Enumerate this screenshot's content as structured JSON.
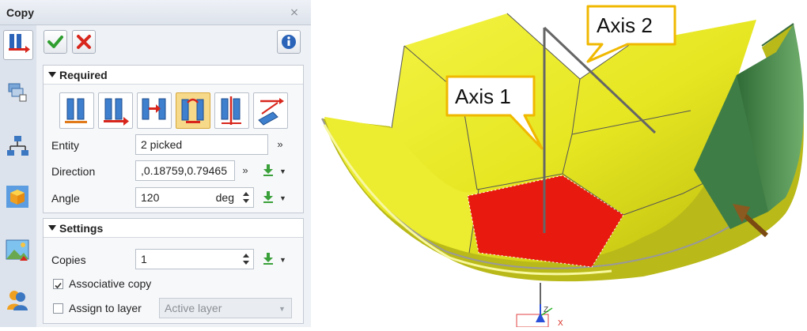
{
  "panel": {
    "title": "Copy",
    "close_glyph": "⨯"
  },
  "sidebar_icons": [
    "copy-tool-icon",
    "layers-icon",
    "hierarchy-icon",
    "cube-icon",
    "image-icon",
    "user-icon"
  ],
  "toolbar": {
    "ok": "OK",
    "cancel": "Cancel",
    "info": "Info"
  },
  "required": {
    "title": "Required",
    "modes": [
      "translate-copy",
      "move-copy",
      "point-to-point-copy",
      "rotate-copy",
      "axis-copy",
      "align-copy"
    ],
    "selected_mode": 3,
    "entity": {
      "label": "Entity",
      "value": "2 picked"
    },
    "direction": {
      "label": "Direction",
      "value": ",0.18759,0.79465"
    },
    "angle": {
      "label": "Angle",
      "value": "120",
      "unit": "deg"
    }
  },
  "settings": {
    "title": "Settings",
    "copies": {
      "label": "Copies",
      "value": "1"
    },
    "associative": {
      "label": "Associative copy",
      "checked": true
    },
    "assign_layer": {
      "label": "Assign to layer",
      "checked": false,
      "value": "Active layer"
    }
  },
  "viewport": {
    "callouts": [
      "Axis 1",
      "Axis 2"
    ],
    "triad": {
      "z": "Z",
      "x": "X"
    },
    "colors": {
      "yellow": "#ecec2a",
      "red": "#e81a10",
      "green": "#3f7d46",
      "callout_border": "#f0b800"
    }
  }
}
